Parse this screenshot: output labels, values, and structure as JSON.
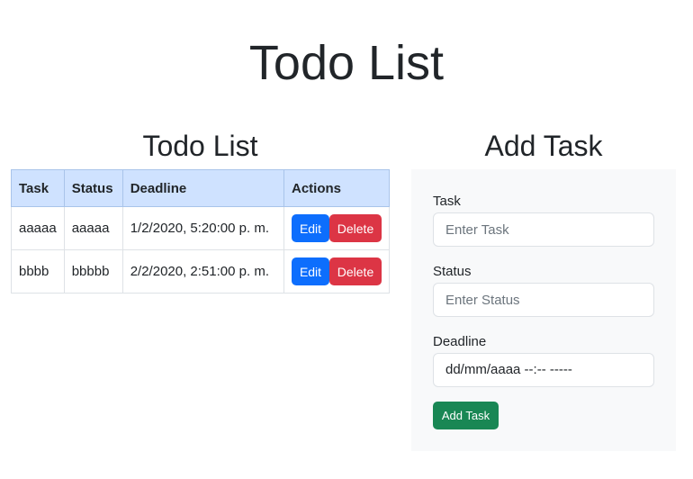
{
  "page": {
    "title": "Todo List"
  },
  "list": {
    "title": "Todo List",
    "columns": [
      "Task",
      "Status",
      "Deadline",
      "Actions"
    ],
    "rows": [
      {
        "task": "aaaaa",
        "status": "aaaaa",
        "deadline": "1/2/2020, 5:20:00 p. m.",
        "edit_label": "Edit",
        "delete_label": "Delete"
      },
      {
        "task": "bbbb",
        "status": "bbbbb",
        "deadline": "2/2/2020, 2:51:00 p. m.",
        "edit_label": "Edit",
        "delete_label": "Delete"
      }
    ]
  },
  "form": {
    "title": "Add Task",
    "task_label": "Task",
    "task_placeholder": "Enter Task",
    "status_label": "Status",
    "status_placeholder": "Enter Status",
    "deadline_label": "Deadline",
    "deadline_value": "dd/mm/aaaa --:-- -----",
    "submit_label": "Add Task"
  },
  "colors": {
    "edit": "#0d6efd",
    "delete": "#dc3545",
    "add": "#198754",
    "table_header": "#cfe2ff"
  }
}
